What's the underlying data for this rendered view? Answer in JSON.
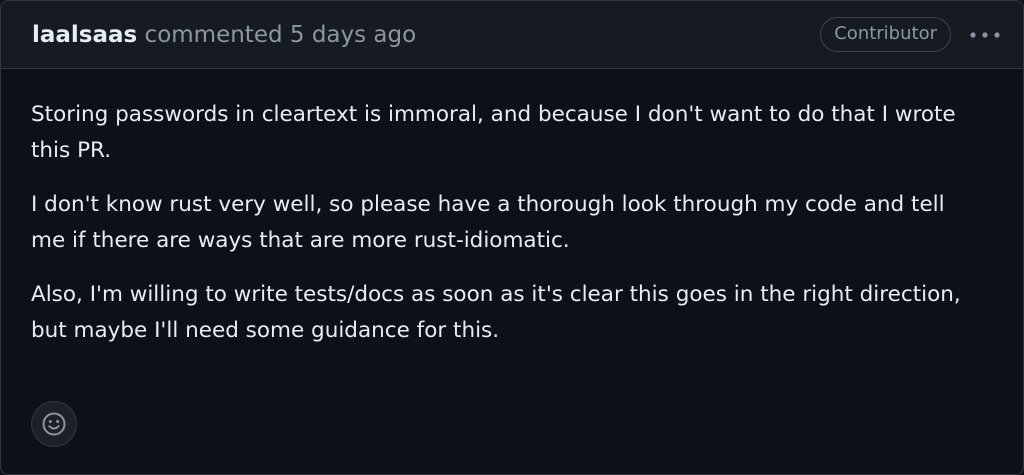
{
  "comment": {
    "author": "laalsaas",
    "action": "commented",
    "timestamp": "5 days ago",
    "role_badge": "Contributor",
    "paragraphs": [
      "Storing passwords in cleartext is immoral, and because I don't want to do that I wrote this PR.",
      "I don't know rust very well, so please have a thorough look through my code and tell me if there are ways that are more rust-idiomatic.",
      "Also, I'm willing to write tests/docs as soon as it's clear this goes in the right direction, but maybe I'll need some guidance for this."
    ]
  },
  "icons": {
    "options": "kebab-horizontal-icon",
    "reaction": "smiley-icon"
  },
  "colors": {
    "background": "#0d1117",
    "header_background": "#161b22",
    "border": "#30363d",
    "text": "#e6edf3",
    "muted": "#8d96a0"
  }
}
